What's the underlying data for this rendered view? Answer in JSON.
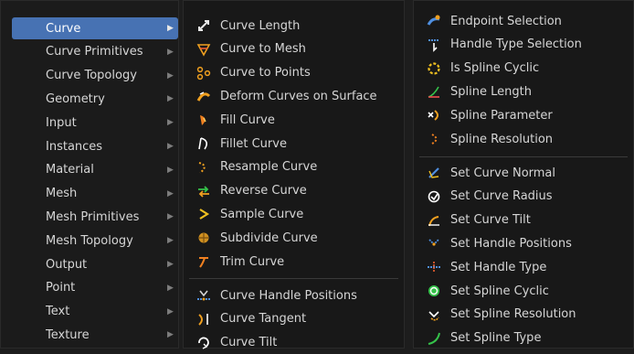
{
  "categories": [
    {
      "label": "Curve",
      "active": true
    },
    {
      "label": "Curve Primitives"
    },
    {
      "label": "Curve Topology"
    },
    {
      "label": "Geometry"
    },
    {
      "label": "Input"
    },
    {
      "label": "Instances"
    },
    {
      "label": "Material"
    },
    {
      "label": "Mesh"
    },
    {
      "label": "Mesh Primitives"
    },
    {
      "label": "Mesh Topology"
    },
    {
      "label": "Output"
    },
    {
      "label": "Point"
    },
    {
      "label": "Text"
    },
    {
      "label": "Texture"
    }
  ],
  "curve_nodes": [
    {
      "label": "Curve Length",
      "icon": "curve-length-icon"
    },
    {
      "label": "Curve to Mesh",
      "icon": "curve-to-mesh-icon"
    },
    {
      "label": "Curve to Points",
      "icon": "curve-to-points-icon"
    },
    {
      "label": "Deform Curves on Surface",
      "icon": "deform-curves-icon"
    },
    {
      "label": "Fill Curve",
      "icon": "fill-curve-icon"
    },
    {
      "label": "Fillet Curve",
      "icon": "fillet-curve-icon"
    },
    {
      "label": "Resample Curve",
      "icon": "resample-curve-icon"
    },
    {
      "label": "Reverse Curve",
      "icon": "reverse-curve-icon"
    },
    {
      "label": "Sample Curve",
      "icon": "sample-curve-icon"
    },
    {
      "label": "Subdivide Curve",
      "icon": "subdivide-curve-icon"
    },
    {
      "label": "Trim Curve",
      "icon": "trim-curve-icon"
    }
  ],
  "curve_read_nodes": [
    {
      "label": "Curve Handle Positions",
      "icon": "curve-handle-positions-icon"
    },
    {
      "label": "Curve Tangent",
      "icon": "curve-tangent-icon"
    },
    {
      "label": "Curve Tilt",
      "icon": "curve-tilt-icon"
    }
  ],
  "spline_read_nodes": [
    {
      "label": "Endpoint Selection",
      "icon": "endpoint-selection-icon"
    },
    {
      "label": "Handle Type Selection",
      "icon": "handle-type-selection-icon"
    },
    {
      "label": "Is Spline Cyclic",
      "icon": "is-spline-cyclic-icon"
    },
    {
      "label": "Spline Length",
      "icon": "spline-length-icon"
    },
    {
      "label": "Spline Parameter",
      "icon": "spline-parameter-icon"
    },
    {
      "label": "Spline Resolution",
      "icon": "spline-resolution-icon"
    }
  ],
  "set_nodes": [
    {
      "label": "Set Curve Normal",
      "icon": "set-curve-normal-icon"
    },
    {
      "label": "Set Curve Radius",
      "icon": "set-curve-radius-icon"
    },
    {
      "label": "Set Curve Tilt",
      "icon": "set-curve-tilt-icon"
    },
    {
      "label": "Set Handle Positions",
      "icon": "set-handle-positions-icon"
    },
    {
      "label": "Set Handle Type",
      "icon": "set-handle-type-icon"
    },
    {
      "label": "Set Spline Cyclic",
      "icon": "set-spline-cyclic-icon"
    },
    {
      "label": "Set Spline Resolution",
      "icon": "set-spline-resolution-icon"
    },
    {
      "label": "Set Spline Type",
      "icon": "set-spline-type-icon"
    }
  ],
  "colors": {
    "highlight": "#4772b3",
    "text": "#d6d6d6",
    "accent_orange": "#f0a020",
    "accent_green": "#35c24a",
    "accent_blue": "#4f8fe0"
  }
}
